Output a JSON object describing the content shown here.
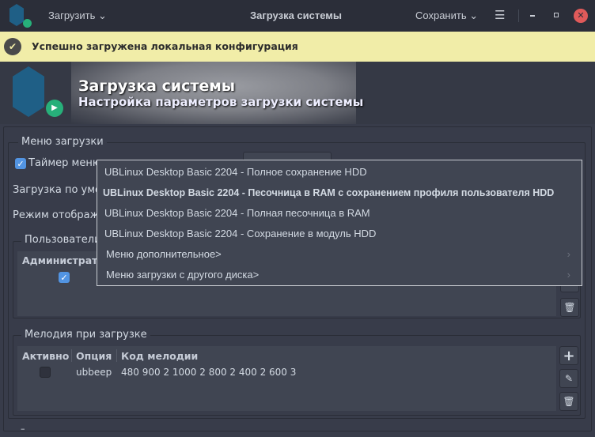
{
  "titlebar": {
    "load_menu": "Загрузить",
    "title": "Загрузка системы",
    "save_menu": "Сохранить"
  },
  "notification": {
    "text": "Успешно загружена локальная конфигурация"
  },
  "header": {
    "title": "Загрузка системы",
    "subtitle": "Настройка параметров загрузки системы"
  },
  "boot_menu": {
    "legend": "Меню загрузки",
    "timer_label": "Таймер меню",
    "timer_checked": true,
    "default_label": "Загрузка по умол",
    "display_label": "Режим отображе"
  },
  "users": {
    "legend": "Пользователи",
    "column_admin": "Администрато",
    "admin_checked": true
  },
  "dropdown": {
    "items": [
      {
        "label": "UBLinux Desktop Basic 2204 - Полное сохранение HDD",
        "selected": false
      },
      {
        "label": "UBLinux Desktop Basic 2204 - Песочница в RAM с сохранением профиля пользователя HDD",
        "selected": true
      },
      {
        "label": "UBLinux Desktop Basic 2204 - Полная песочница в RAM",
        "selected": false
      },
      {
        "label": "UBLinux Desktop Basic 2204 - Сохранение в модуль HDD",
        "selected": false
      },
      {
        "label": "Меню дополнительное>",
        "submenu": true
      },
      {
        "label": "Меню загрузки с другого диска>",
        "submenu": true
      }
    ]
  },
  "melody": {
    "legend": "Мелодия при загрузке",
    "columns": [
      "Активно",
      "Опция",
      "Код мелодии"
    ],
    "rows": [
      {
        "active": false,
        "option": "ubbeep",
        "code": "480 900 2 1000 2 800 2 400 2 600 3"
      }
    ]
  },
  "footer": {
    "collapse": "–"
  },
  "colors": {
    "accent": "#5294e2",
    "banner": "#f1eda8",
    "close": "#e05a5a"
  }
}
